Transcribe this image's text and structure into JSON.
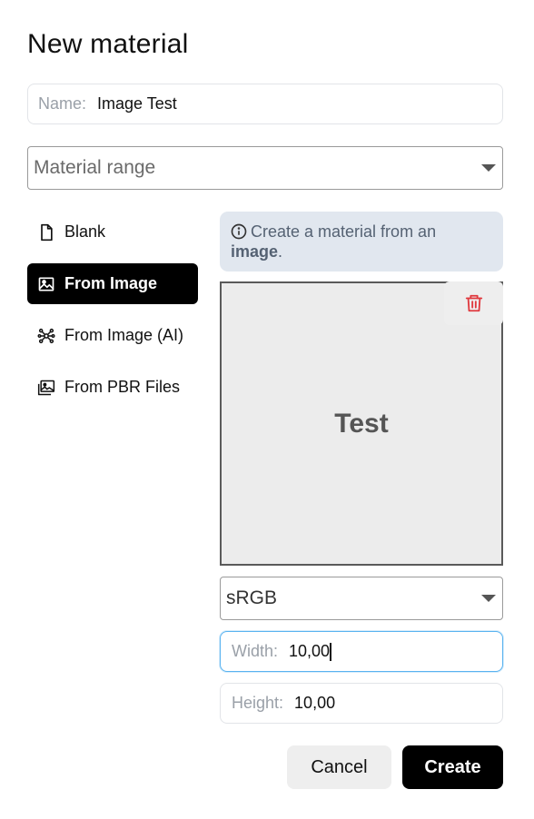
{
  "dialog": {
    "title": "New material"
  },
  "name_field": {
    "label": "Name:",
    "value": "Image Test"
  },
  "range_select": {
    "value": "Material range"
  },
  "nav": {
    "items": [
      {
        "label": "Blank",
        "icon": "file-icon",
        "active": false
      },
      {
        "label": "From Image",
        "icon": "image-icon",
        "active": true
      },
      {
        "label": "From Image (AI)",
        "icon": "ai-network-icon",
        "active": false
      },
      {
        "label": "From PBR Files",
        "icon": "images-stack-icon",
        "active": false
      }
    ]
  },
  "info": {
    "text_before": "Create a material from an",
    "highlight": "image",
    "text_after": "."
  },
  "preview": {
    "text": "Test"
  },
  "color_space_select": {
    "value": "sRGB"
  },
  "width_field": {
    "label": "Width:",
    "value": "10,00"
  },
  "height_field": {
    "label": "Height:",
    "value": "10,00"
  },
  "footer": {
    "cancel_label": "Cancel",
    "create_label": "Create"
  },
  "colors": {
    "primary": "#000000",
    "focus": "#5ab3f0",
    "info_bg": "#e1e7ef",
    "danger": "#e0393e"
  }
}
